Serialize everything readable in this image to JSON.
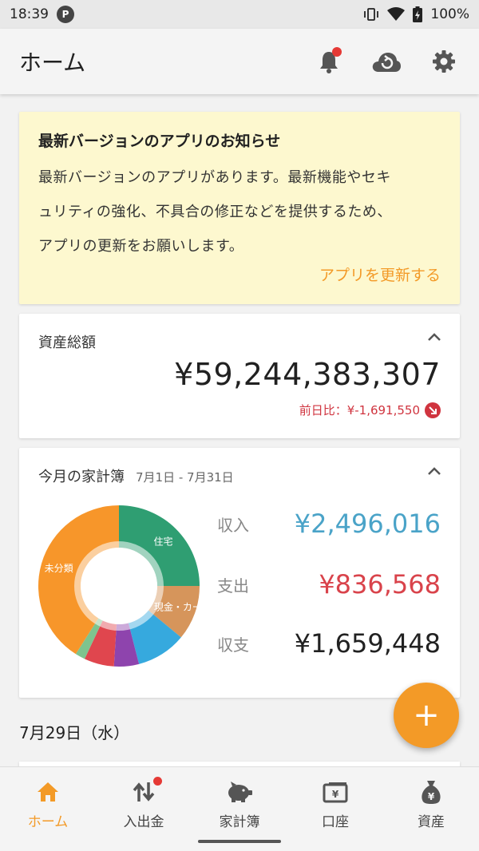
{
  "status_bar": {
    "time": "18:39",
    "battery": "100%"
  },
  "app_bar": {
    "title": "ホーム"
  },
  "notice": {
    "title": "最新バージョンのアプリのお知らせ",
    "body_lines": [
      "最新バージョンのアプリがあります。最新機能やセキ",
      "ュリティの強化、不具合の修正などを提供するため、",
      "アプリの更新をお願いします。"
    ],
    "action": "アプリを更新する"
  },
  "assets": {
    "label": "資産総額",
    "value": "¥59,244,383,307",
    "diff": "前日比：¥-1,691,550"
  },
  "budget": {
    "title": "今月の家計簿",
    "range": "7月1日 - 7月31日",
    "rows": [
      {
        "label": "収入",
        "value": "¥2,496,016",
        "color": "#4aa3c8"
      },
      {
        "label": "支出",
        "value": "¥836,568",
        "color": "#d9434b"
      },
      {
        "label": "収支",
        "value": "¥1,659,448",
        "color": "#212121"
      }
    ]
  },
  "chart_data": {
    "type": "pie",
    "categories": [
      "住宅",
      "現金・カー",
      "",
      "",
      "",
      "",
      "未分類"
    ],
    "values": [
      25,
      11,
      10,
      5,
      6,
      2,
      41
    ],
    "colors": [
      "#2f9e72",
      "#d6955b",
      "#36a9de",
      "#8e44ad",
      "#e0464e",
      "#7ec48e",
      "#f7962a"
    ],
    "labels_shown": [
      "住宅",
      "現金・カー",
      "未分類"
    ]
  },
  "date_label": "7月29日（水）",
  "fab": {
    "label": "+"
  },
  "bottom_nav": [
    {
      "label": "ホーム",
      "icon": "home-icon"
    },
    {
      "label": "入出金",
      "icon": "transfer-icon"
    },
    {
      "label": "家計簿",
      "icon": "piggy-bank-icon"
    },
    {
      "label": "口座",
      "icon": "wallet-icon"
    },
    {
      "label": "資産",
      "icon": "money-bag-icon"
    }
  ],
  "colors": {
    "accent": "#f39a27",
    "negative": "#d0343f"
  }
}
